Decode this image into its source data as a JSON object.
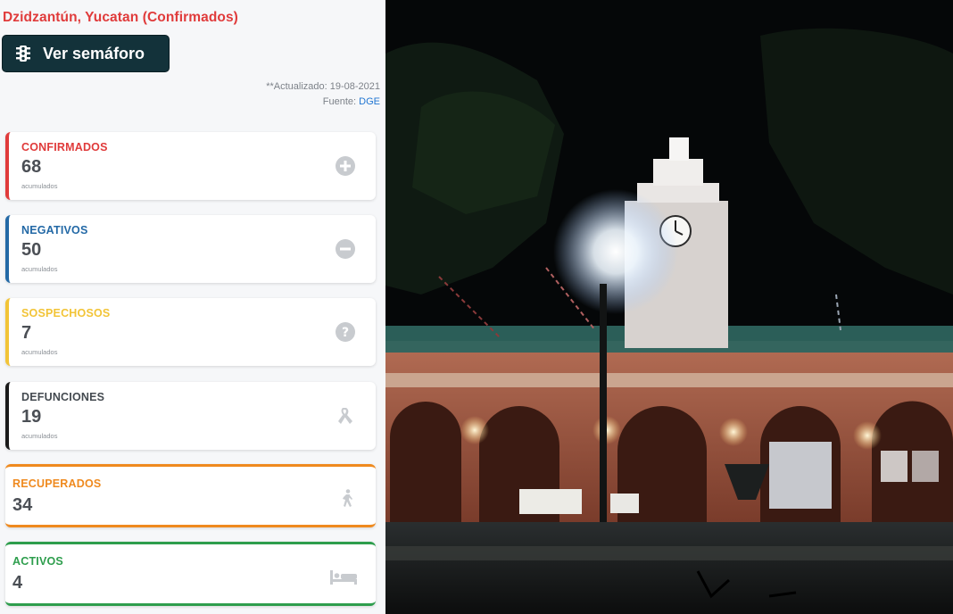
{
  "header": {
    "title": "Dzidzantún, Yucatan (Confirmados)",
    "semaforo_button": "Ver semáforo",
    "semaforo_icon": "traffic-light-icon",
    "updated": "**Actualizado: 19-08-2021",
    "source_prefix": "Fuente: ",
    "source_link": "DGE"
  },
  "cards": {
    "confirmados": {
      "label": "CONFIRMADOS",
      "value": "68",
      "sub": "acumulados",
      "icon": "plus-circle-icon",
      "color": "#e03b3b"
    },
    "negativos": {
      "label": "NEGATIVOS",
      "value": "50",
      "sub": "acumulados",
      "icon": "minus-circle-icon",
      "color": "#2369a6"
    },
    "sospechosos": {
      "label": "SOSPECHOSOS",
      "value": "7",
      "sub": "acumulados",
      "icon": "question-circle-icon",
      "color": "#f2c437"
    },
    "defunciones": {
      "label": "DEFUNCIONES",
      "value": "19",
      "sub": "acumulados",
      "icon": "ribbon-icon",
      "color": "#1a1a1a"
    },
    "recuperados": {
      "label": "RECUPERADOS",
      "value": "34",
      "icon": "walking-icon",
      "color": "#ef8a1f"
    },
    "activos": {
      "label": "ACTIVOS",
      "value": "4",
      "icon": "bed-icon",
      "color": "#2e9e4d"
    }
  },
  "photo": {
    "description_icon": "town-hall-night-photo"
  }
}
